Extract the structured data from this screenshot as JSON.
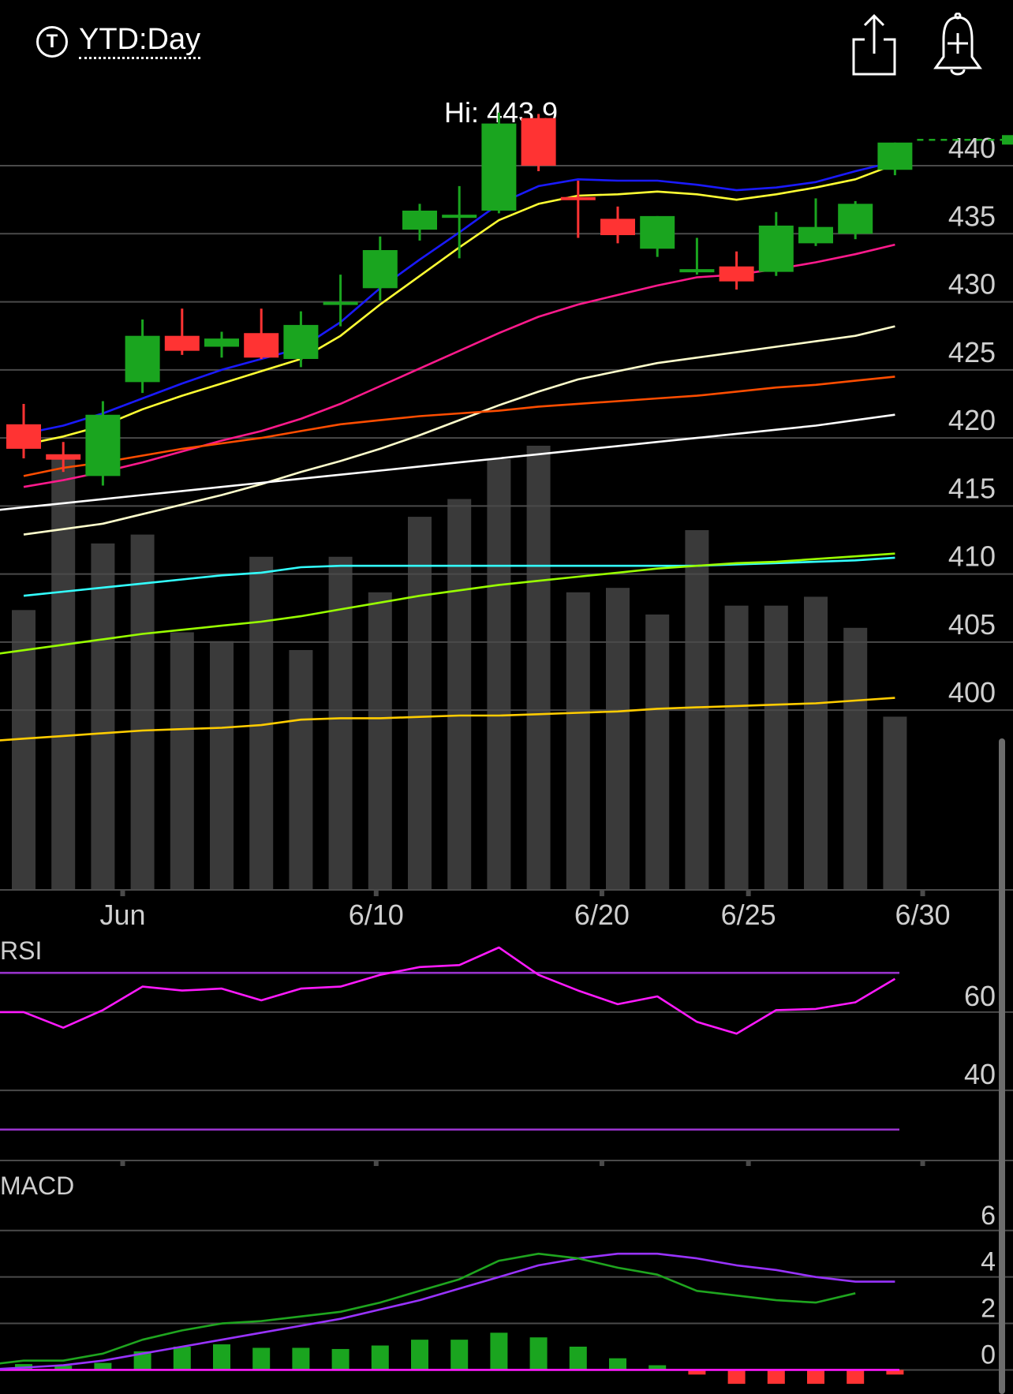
{
  "header": {
    "range_icon_glyph": "T",
    "range_label": "YTD:Day",
    "share_icon": "share-icon",
    "alert_icon": "add-alert-bell-icon"
  },
  "hi_label": "Hi: 443.9",
  "colors": {
    "up": "#1aa51f",
    "down": "#ff3333",
    "volume": "#3a3a3a",
    "grid": "#4a4a4a",
    "axis_text": "#cfcfcf",
    "ma_blue": "#1a1aff",
    "ma_yellow": "#ffff33",
    "ma_magenta": "#ff1a8c",
    "ma_cream": "#ffffcc",
    "ma_orange": "#ff4d00",
    "ma_white": "#ffffff",
    "ma_cyan": "#33ffff",
    "ma_lime": "#99ff00",
    "ma_gold": "#ffcc00",
    "rsi": "#ff1aff",
    "rsi_bands": "#9933cc",
    "macd": "#1fa51f",
    "macd_signal": "#9933ff",
    "macd_zero": "#ff1aff"
  },
  "chart_data": [
    {
      "type": "candlestick",
      "panel": "price",
      "x_ticks": [
        "Jun",
        "6/10",
        "6/20",
        "6/25",
        "6/30"
      ],
      "x_tick_index": [
        2.5,
        8.9,
        14.6,
        18.3,
        22.7
      ],
      "y_ticks": [
        440,
        435,
        430,
        425,
        420,
        415,
        410,
        405,
        400
      ],
      "ylim": [
        391.6,
        445.8
      ],
      "last_price_line": 441.9,
      "candles": [
        {
          "o": 421.0,
          "h": 422.5,
          "l": 418.5,
          "c": 419.2
        },
        {
          "o": 418.8,
          "h": 419.7,
          "l": 417.5,
          "c": 418.4
        },
        {
          "o": 417.2,
          "h": 422.7,
          "l": 416.5,
          "c": 421.7
        },
        {
          "o": 424.1,
          "h": 428.7,
          "l": 423.3,
          "c": 427.5
        },
        {
          "o": 427.5,
          "h": 429.5,
          "l": 426.1,
          "c": 426.4
        },
        {
          "o": 426.7,
          "h": 427.8,
          "l": 425.9,
          "c": 427.3
        },
        {
          "o": 427.7,
          "h": 429.5,
          "l": 425.8,
          "c": 425.9
        },
        {
          "o": 425.8,
          "h": 429.3,
          "l": 425.2,
          "c": 428.3
        },
        {
          "o": 430.0,
          "h": 432.0,
          "l": 428.2,
          "c": 430.0
        },
        {
          "o": 431.0,
          "h": 434.8,
          "l": 430.1,
          "c": 433.8
        },
        {
          "o": 435.3,
          "h": 437.2,
          "l": 434.5,
          "c": 436.7
        },
        {
          "o": 436.4,
          "h": 438.5,
          "l": 433.2,
          "c": 436.4
        },
        {
          "o": 436.7,
          "h": 443.9,
          "l": 436.5,
          "c": 443.1
        },
        {
          "o": 443.5,
          "h": 443.8,
          "l": 439.6,
          "c": 440.0
        },
        {
          "o": 437.7,
          "h": 438.9,
          "l": 434.7,
          "c": 437.5
        },
        {
          "o": 436.1,
          "h": 437.0,
          "l": 434.3,
          "c": 434.9
        },
        {
          "o": 433.9,
          "h": 436.3,
          "l": 433.3,
          "c": 436.3
        },
        {
          "o": 432.4,
          "h": 434.7,
          "l": 432.0,
          "c": 432.4
        },
        {
          "o": 432.6,
          "h": 433.7,
          "l": 430.9,
          "c": 431.5
        },
        {
          "o": 432.2,
          "h": 436.6,
          "l": 431.9,
          "c": 435.6
        },
        {
          "o": 434.3,
          "h": 437.6,
          "l": 434.1,
          "c": 435.5
        },
        {
          "o": 435.0,
          "h": 437.4,
          "l": 434.6,
          "c": 437.2
        },
        {
          "o": 439.7,
          "h": 441.7,
          "l": 439.3,
          "c": 441.7
        }
      ],
      "volume_relative": [
        0.63,
        0.97,
        0.78,
        0.8,
        0.58,
        0.56,
        0.75,
        0.54,
        0.75,
        0.67,
        0.84,
        0.88,
        0.97,
        1.0,
        0.67,
        0.68,
        0.62,
        0.81,
        0.64,
        0.64,
        0.66,
        0.59,
        0.39
      ],
      "moving_averages": [
        {
          "color_key": "ma_blue",
          "values": [
            420.3,
            420.9,
            421.8,
            422.9,
            424.0,
            425.0,
            425.8,
            426.6,
            428.5,
            431.0,
            433.1,
            435.1,
            437.2,
            438.5,
            439.0,
            438.9,
            438.9,
            438.6,
            438.2,
            438.4,
            438.8,
            439.6,
            440.3
          ]
        },
        {
          "color_key": "ma_yellow",
          "values": [
            419.5,
            420.1,
            420.9,
            422.1,
            423.1,
            424.0,
            424.9,
            425.8,
            427.5,
            429.8,
            431.9,
            434.0,
            436.0,
            437.2,
            437.8,
            437.9,
            438.1,
            437.9,
            437.5,
            437.9,
            438.4,
            439.0,
            440.1
          ]
        },
        {
          "color_key": "ma_magenta",
          "values": [
            416.4,
            416.9,
            417.5,
            418.2,
            419.0,
            419.8,
            420.5,
            421.4,
            422.5,
            423.8,
            425.1,
            426.4,
            427.7,
            428.9,
            429.8,
            430.5,
            431.2,
            431.8,
            432.0,
            432.4,
            432.9,
            433.5,
            434.2
          ]
        },
        {
          "color_key": "ma_cream",
          "values": [
            412.9,
            413.3,
            413.7,
            414.4,
            415.1,
            415.8,
            416.6,
            417.5,
            418.3,
            419.2,
            420.2,
            421.3,
            422.4,
            423.4,
            424.3,
            424.9,
            425.5,
            425.9,
            426.3,
            426.7,
            427.1,
            427.5,
            428.2
          ]
        },
        {
          "color_key": "ma_orange",
          "values": [
            417.2,
            417.8,
            418.2,
            418.7,
            419.2,
            419.6,
            420.0,
            420.5,
            421.0,
            421.3,
            421.6,
            421.8,
            422.0,
            422.3,
            422.5,
            422.7,
            422.9,
            423.1,
            423.4,
            423.7,
            423.9,
            424.2,
            424.5
          ]
        },
        {
          "color_key": "ma_white",
          "values": [
            414.6,
            414.9,
            415.2,
            415.5,
            415.8,
            416.1,
            416.4,
            416.7,
            417.0,
            417.3,
            417.6,
            417.9,
            418.2,
            418.5,
            418.8,
            419.1,
            419.4,
            419.7,
            420.0,
            420.3,
            420.6,
            420.9,
            421.3,
            421.7
          ]
        },
        {
          "color_key": "ma_cyan",
          "values": [
            408.4,
            408.7,
            409.0,
            409.3,
            409.6,
            409.9,
            410.1,
            410.5,
            410.6,
            410.6,
            410.6,
            410.6,
            410.6,
            410.6,
            410.6,
            410.6,
            410.6,
            410.6,
            410.7,
            410.8,
            410.9,
            411.0,
            411.2
          ]
        },
        {
          "color_key": "ma_lime",
          "values": [
            404.0,
            404.4,
            404.8,
            405.2,
            405.6,
            405.9,
            406.2,
            406.5,
            406.9,
            407.4,
            407.9,
            408.4,
            408.8,
            409.2,
            409.5,
            409.8,
            410.1,
            410.4,
            410.6,
            410.8,
            410.9,
            411.1,
            411.3,
            411.5
          ]
        },
        {
          "color_key": "ma_gold",
          "values": [
            397.7,
            397.9,
            398.1,
            398.3,
            398.5,
            398.6,
            398.7,
            398.9,
            399.3,
            399.4,
            399.4,
            399.5,
            399.6,
            399.6,
            399.7,
            399.8,
            399.9,
            400.1,
            400.2,
            400.3,
            400.4,
            400.5,
            400.7,
            400.9
          ]
        }
      ]
    },
    {
      "type": "line",
      "panel": "rsi",
      "label": "RSI",
      "y_ticks": [
        60,
        40
      ],
      "ylim": [
        22.3,
        77.7
      ],
      "bands": [
        70,
        30
      ],
      "values": [
        60.0,
        60.0,
        56.0,
        60.5,
        66.5,
        65.5,
        66.0,
        63.0,
        66.0,
        66.5,
        69.5,
        71.5,
        72.0,
        76.5,
        69.5,
        65.5,
        62.0,
        64.0,
        57.5,
        54.5,
        60.5,
        60.8,
        62.5,
        68.5
      ]
    },
    {
      "type": "line",
      "panel": "macd",
      "label": "MACD",
      "y_ticks": [
        6,
        4,
        2,
        0
      ],
      "ylim": [
        -0.8,
        8.2
      ],
      "macd": [
        0.2,
        0.4,
        0.4,
        0.7,
        1.3,
        1.7,
        2.0,
        2.1,
        2.3,
        2.5,
        2.9,
        3.4,
        3.9,
        4.7,
        5.0,
        4.8,
        4.4,
        4.1,
        3.4,
        3.2,
        3.0,
        2.9,
        3.3
      ],
      "signal": [
        0.0,
        0.1,
        0.2,
        0.4,
        0.7,
        1.0,
        1.3,
        1.6,
        1.9,
        2.2,
        2.6,
        3.0,
        3.5,
        4.0,
        4.5,
        4.8,
        5.0,
        5.0,
        4.8,
        4.5,
        4.3,
        4.0,
        3.8,
        3.8
      ],
      "histogram": [
        0.25,
        0.18,
        0.3,
        0.8,
        1.0,
        1.1,
        0.95,
        0.95,
        0.9,
        1.05,
        1.3,
        1.3,
        1.6,
        1.4,
        1.0,
        0.5,
        0.2,
        -0.2,
        -0.6,
        -0.6,
        -0.6,
        -0.6,
        -0.2
      ]
    }
  ]
}
